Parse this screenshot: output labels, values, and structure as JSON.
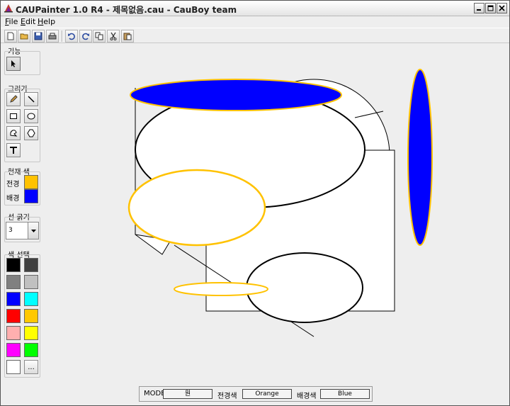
{
  "window": {
    "title": "CAUPainter 1.0 R4 - 제목없음.cau - CauBoy team",
    "buttons": {
      "minimize": "minimize-icon",
      "maximize": "maximize-icon",
      "close": "close-icon"
    }
  },
  "menu": [
    {
      "label": "File",
      "mnemonic": "F",
      "rest": "ile"
    },
    {
      "label": "Edit",
      "mnemonic": "E",
      "rest": "dit"
    },
    {
      "label": "Help",
      "mnemonic": "H",
      "rest": "elp"
    }
  ],
  "toolbar": {
    "buttons": [
      "new-file-icon",
      "open-folder-icon",
      "save-icon",
      "print-icon",
      "undo-icon",
      "redo-icon",
      "copy-icon",
      "cut-icon",
      "paste-icon"
    ]
  },
  "sidebar": {
    "function_label": "기능",
    "draw_label": "그리기",
    "current_color_label": "현재 색",
    "foreground_label": "전경",
    "background_label": "배경",
    "line_width_label": "선 굵기",
    "line_width_value": "3",
    "palette_label": "색 선택",
    "more_colors_label": "...",
    "foreground_color": "#ffc200",
    "background_color": "#0000ff",
    "palette": [
      "#000000",
      "#404040",
      "#808080",
      "#c0c0c0",
      "#0000ff",
      "#00ffff",
      "#ff0000",
      "#ffc800",
      "#ffafaf",
      "#ffff00",
      "#ff00ff",
      "#00ff00",
      "#ffffff"
    ]
  },
  "statusbar": {
    "mode_label": "MODE",
    "mode_value": "원",
    "fg_label": "전경색",
    "fg_value": "Orange",
    "bg_label": "배경색",
    "bg_value": "Blue"
  }
}
